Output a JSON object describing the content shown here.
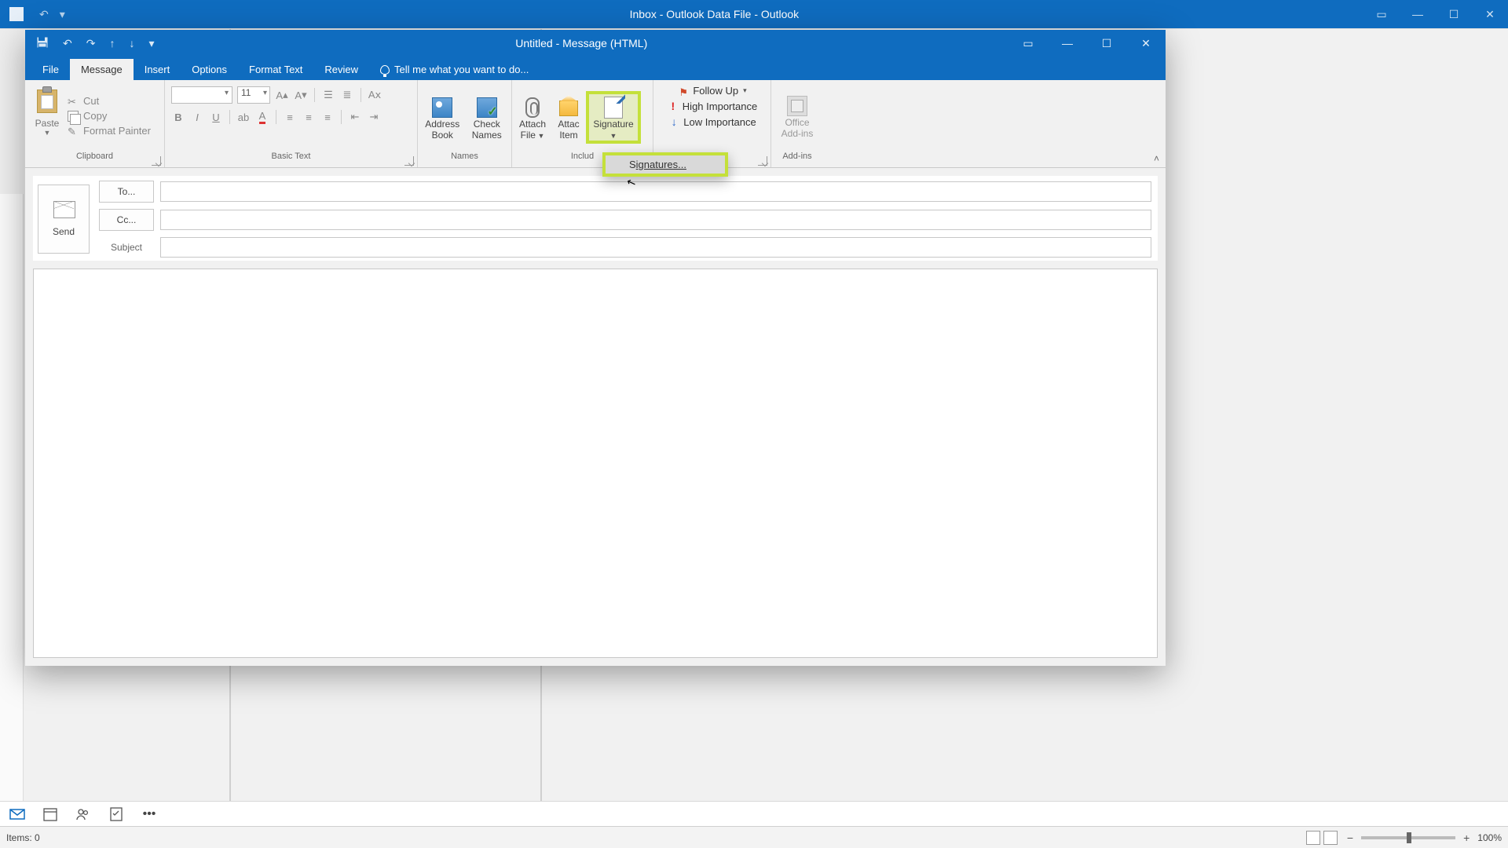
{
  "main_window": {
    "title": "Inbox - Outlook Data File - Outlook",
    "statusbar": {
      "items_label": "Items: 0",
      "zoom_label": "100%"
    }
  },
  "compose_window": {
    "title": "Untitled - Message (HTML)",
    "tabs": {
      "file": "File",
      "message": "Message",
      "insert": "Insert",
      "options": "Options",
      "format_text": "Format Text",
      "review": "Review",
      "tellme": "Tell me what you want to do..."
    },
    "ribbon": {
      "clipboard": {
        "label": "Clipboard",
        "paste": "Paste",
        "cut": "Cut",
        "copy": "Copy",
        "format_painter": "Format Painter"
      },
      "basic_text": {
        "label": "Basic Text",
        "font_name": "",
        "font_size": "11"
      },
      "names": {
        "label": "Names",
        "address_book_l1": "Address",
        "address_book_l2": "Book",
        "check_names_l1": "Check",
        "check_names_l2": "Names"
      },
      "include": {
        "label": "Includ",
        "attach_file_l1": "Attach",
        "attach_file_l2": "File",
        "attach_item_l1": "Attac",
        "attach_item_l2": "Item",
        "signature": "Signature"
      },
      "tags": {
        "follow_up": "Follow Up",
        "high_importance": "High Importance",
        "low_importance": "Low Importance"
      },
      "addins": {
        "label": "Add-ins",
        "office_addins_l1": "Office",
        "office_addins_l2": "Add-ins"
      }
    },
    "signature_menu": {
      "signatures_prefix": "S",
      "signatures_rest": "ignatures..."
    },
    "fields": {
      "send": "Send",
      "to": "To...",
      "cc": "Cc...",
      "subject": "Subject"
    }
  }
}
